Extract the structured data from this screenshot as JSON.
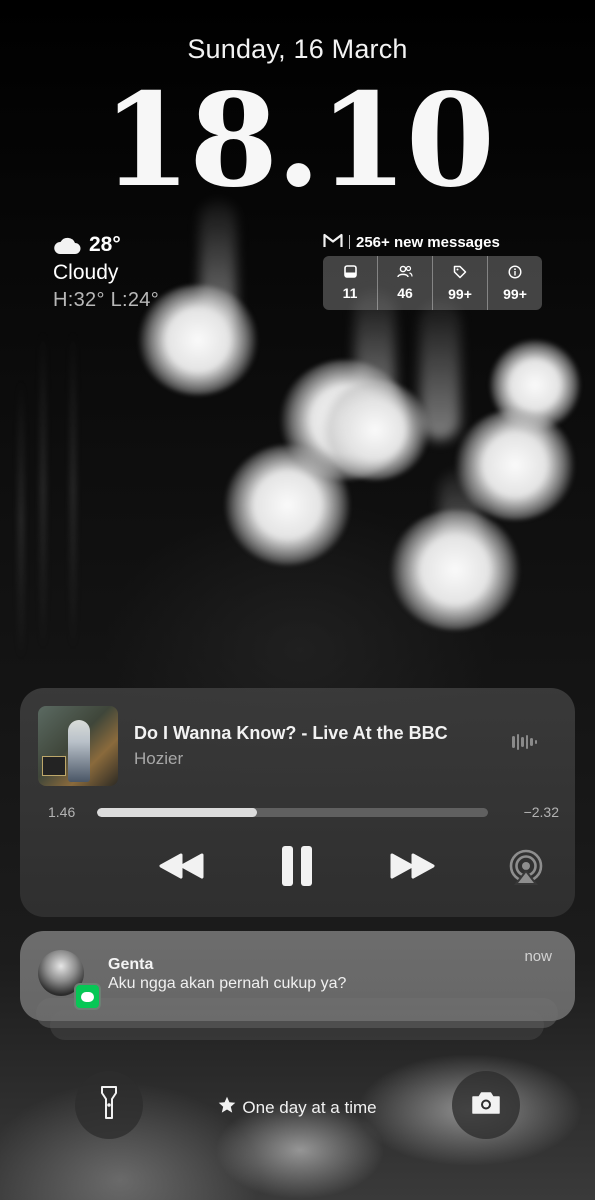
{
  "lockscreen": {
    "date": "Sunday, 16 March",
    "time": "18.10"
  },
  "weather": {
    "icon": "cloud-icon",
    "temperature": "28°",
    "condition": "Cloudy",
    "high_low": "H:32° L:24°"
  },
  "gmail": {
    "icon": "gmail-icon",
    "summary": "256+ new messages",
    "categories": [
      {
        "icon": "inbox-icon",
        "count": "11"
      },
      {
        "icon": "people-icon",
        "count": "46"
      },
      {
        "icon": "tag-icon",
        "count": "99+"
      },
      {
        "icon": "info-icon",
        "count": "99+"
      }
    ]
  },
  "now_playing": {
    "title": "Do I Wanna Know? - Live At the BBC",
    "artist": "Hozier",
    "elapsed": "1.46",
    "remaining": "−2.32",
    "progress": 0.41
  },
  "notification": {
    "app_icon": "line-icon",
    "sender": "Genta",
    "message": "Aku ngga akan pernah cukup ya?",
    "time": "now"
  },
  "bottom": {
    "motto": "One day at a time",
    "left_button_icon": "flashlight-icon",
    "right_button_icon": "camera-icon"
  },
  "colors": {
    "line_green": "#06c755",
    "progress_fill": "#dcdcdc"
  }
}
